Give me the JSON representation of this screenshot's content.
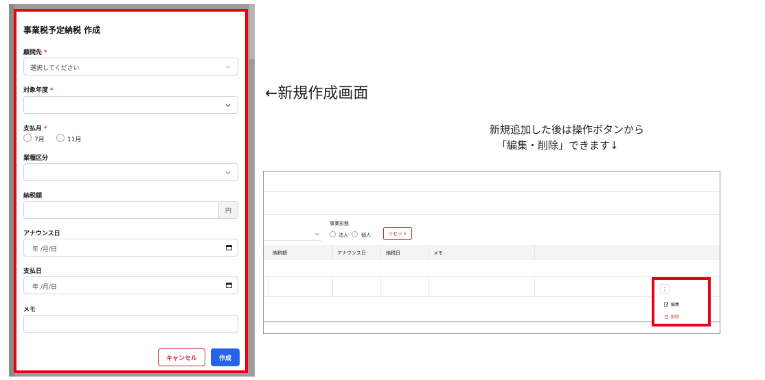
{
  "modal": {
    "title": "事業税予定納税 作成",
    "client": {
      "label": "顧問先",
      "required": "*",
      "placeholder": "選択してください"
    },
    "fiscal_year": {
      "label": "対象年度",
      "required": "*",
      "value": ""
    },
    "pay_month": {
      "label": "支払月",
      "required": "*",
      "options": [
        "7月",
        "11月"
      ]
    },
    "industry": {
      "label": "業種区分",
      "value": ""
    },
    "tax_amount": {
      "label": "納税額",
      "unit": "円",
      "value": ""
    },
    "announce_date": {
      "label": "アナウンス日",
      "value": "年 /月/日"
    },
    "pay_date": {
      "label": "支払日",
      "value": "年 /月/日"
    },
    "memo": {
      "label": "メモ",
      "value": ""
    },
    "cancel_label": "キャンセル",
    "create_label": "作成"
  },
  "captions": {
    "new_screen": "←新規作成画面",
    "note_line1": "新規追加した後は操作ボタンから",
    "note_line2": "「編集・削除」できます↓"
  },
  "list": {
    "business_type_label": "事業形態",
    "radio_options": [
      "法人",
      "個人"
    ],
    "reset_label": "リセット",
    "columns": [
      "納税額",
      "アナウンス日",
      "納税日",
      "メモ"
    ],
    "actions": {
      "kebab": "⋮",
      "edit": "編集",
      "delete": "削除"
    }
  },
  "colors": {
    "highlight": "#e30613",
    "primary": "#2563eb",
    "danger": "#c62828"
  }
}
